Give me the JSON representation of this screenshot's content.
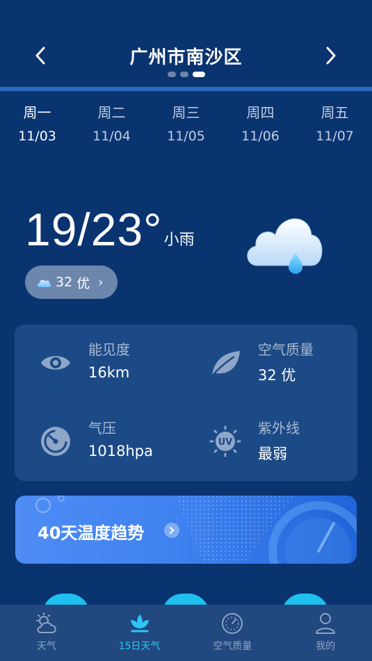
{
  "header": {
    "city": "广州市南沙区",
    "page_dots": 3,
    "active_dot": 2
  },
  "days": [
    {
      "name": "周一",
      "date": "11/03",
      "active": true
    },
    {
      "name": "周二",
      "date": "11/04",
      "active": false
    },
    {
      "name": "周三",
      "date": "11/05",
      "active": false
    },
    {
      "name": "周四",
      "date": "11/06",
      "active": false
    },
    {
      "name": "周五",
      "date": "11/07",
      "active": false
    }
  ],
  "current": {
    "temp_range": "19/23°",
    "condition": "小雨",
    "aqi_value": "32",
    "aqi_level": "优",
    "condition_icon": "cloud-rain-icon"
  },
  "stats": {
    "visibility": {
      "label": "能见度",
      "value": "16km",
      "icon": "eye-icon"
    },
    "air_quality": {
      "label": "空气质量",
      "value": "32 优",
      "icon": "leaf-icon"
    },
    "pressure": {
      "label": "气压",
      "value": "1018hpa",
      "icon": "gauge-icon"
    },
    "uv": {
      "label": "紫外线",
      "value": "最弱",
      "icon": "uv-icon"
    }
  },
  "banner": {
    "title": "40天温度趋势"
  },
  "tabbar": [
    {
      "label": "天气",
      "icon": "sun-cloud-icon",
      "active": false
    },
    {
      "label": "15日天气",
      "icon": "lotus-icon",
      "active": true
    },
    {
      "label": "空气质量",
      "icon": "air-dial-icon",
      "active": false
    },
    {
      "label": "我的",
      "icon": "user-icon",
      "active": false
    }
  ],
  "colors": {
    "background": "#0a3470",
    "card": "#1c4a86",
    "accent": "#2fc6f7",
    "divider": "#2a6bc2"
  }
}
